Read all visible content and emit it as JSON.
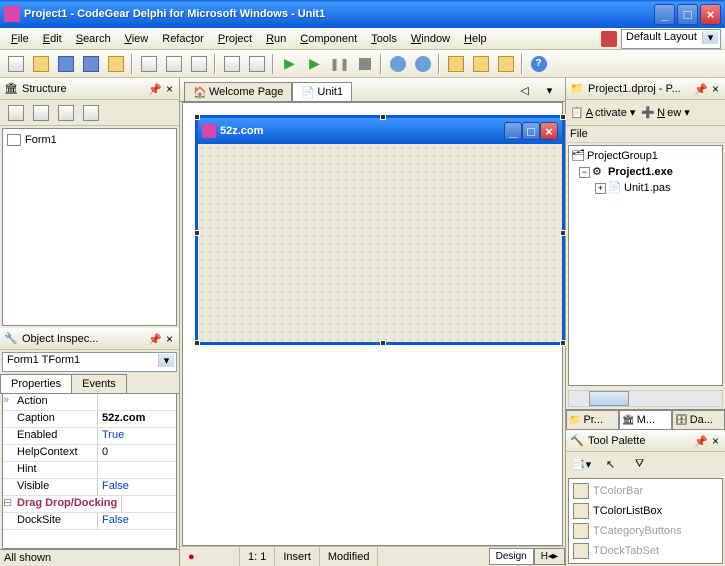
{
  "window": {
    "title": "Project1 - CodeGear Delphi for Microsoft Windows - Unit1"
  },
  "menu": {
    "file": "File",
    "edit": "Edit",
    "search": "Search",
    "view": "View",
    "refactor": "Refactor",
    "project": "Project",
    "run": "Run",
    "component": "Component",
    "tools": "Tools",
    "window": "Window",
    "help": "Help"
  },
  "layout_combo": "Default Layout",
  "structure": {
    "title": "Structure",
    "item": "Form1"
  },
  "inspector": {
    "title": "Object Inspec...",
    "combo": "Form1  TForm1",
    "tabs": {
      "props": "Properties",
      "events": "Events"
    },
    "rows": [
      {
        "name": "Action",
        "val": ""
      },
      {
        "name": "Caption",
        "val": "52z.com",
        "bold": true
      },
      {
        "name": "Enabled",
        "val": "True",
        "blue": true
      },
      {
        "name": "HelpContext",
        "val": "0"
      },
      {
        "name": "Hint",
        "val": ""
      },
      {
        "name": "Visible",
        "val": "False",
        "blue": true
      }
    ],
    "cat": "Drag Drop/Docking",
    "rows2": [
      {
        "name": "DockSite",
        "val": "False",
        "blue": true
      }
    ],
    "footer": "All shown"
  },
  "docs": {
    "welcome": "Welcome Page",
    "unit": "Unit1"
  },
  "form": {
    "title": "52z.com"
  },
  "status": {
    "pos": "1:   1",
    "ins": "Insert",
    "mod": "Modified",
    "design": "Design"
  },
  "project": {
    "title": "Project1.dproj - P...",
    "activate": "Activate",
    "new": "New",
    "file_hdr": "File",
    "items": {
      "group": "ProjectGroup1",
      "exe": "Project1.exe",
      "unit": "Unit1.pas"
    }
  },
  "btabs": {
    "pr": "Pr...",
    "m": "M...",
    "da": "Da..."
  },
  "palette": {
    "title": "Tool Palette",
    "items": [
      "TColorBar",
      "TColorListBox",
      "TCategoryButtons",
      "TDockTabSet"
    ]
  }
}
